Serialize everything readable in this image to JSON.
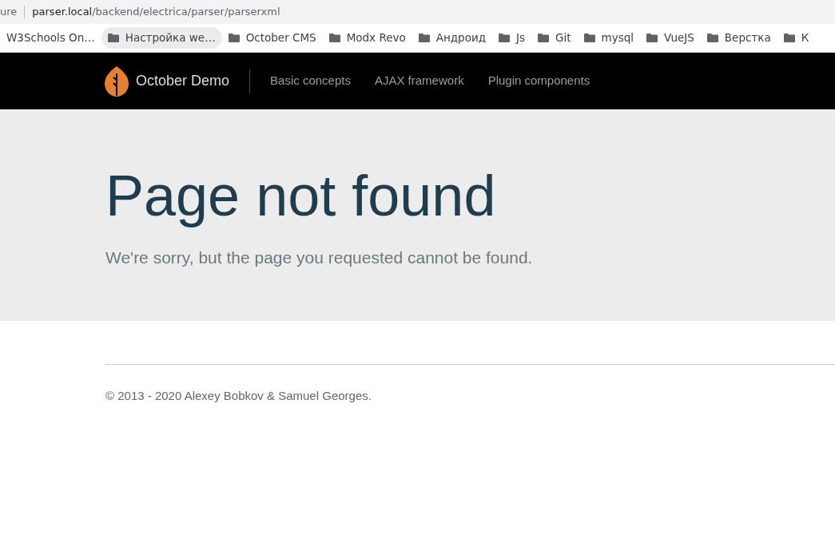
{
  "browser": {
    "address": {
      "security_label": "ure",
      "host": "parser.local",
      "path": "/backend/electrica/parser/parserxml"
    },
    "bookmarks": [
      {
        "label": "W3Schools On…",
        "kind": "page",
        "highlighted": false
      },
      {
        "label": "Настройка we…",
        "kind": "folder",
        "highlighted": true
      },
      {
        "label": "October CMS",
        "kind": "folder",
        "highlighted": false
      },
      {
        "label": "Modx Revo",
        "kind": "folder",
        "highlighted": false
      },
      {
        "label": "Андроид",
        "kind": "folder",
        "highlighted": false
      },
      {
        "label": "Js",
        "kind": "folder",
        "highlighted": false
      },
      {
        "label": "Git",
        "kind": "folder",
        "highlighted": false
      },
      {
        "label": "mysql",
        "kind": "folder",
        "highlighted": false
      },
      {
        "label": "VueJS",
        "kind": "folder",
        "highlighted": false
      },
      {
        "label": "Верстка",
        "kind": "folder",
        "highlighted": false
      },
      {
        "label": "К",
        "kind": "folder",
        "highlighted": false
      }
    ]
  },
  "navbar": {
    "brand": "October Demo",
    "links": [
      "Basic concepts",
      "AJAX framework",
      "Plugin components"
    ]
  },
  "hero": {
    "title": "Page not found",
    "subtitle": "We're sorry, but the page you requested cannot be found."
  },
  "footer": {
    "text": "© 2013 - 2020 Alexey Bobkov & Samuel Georges."
  }
}
